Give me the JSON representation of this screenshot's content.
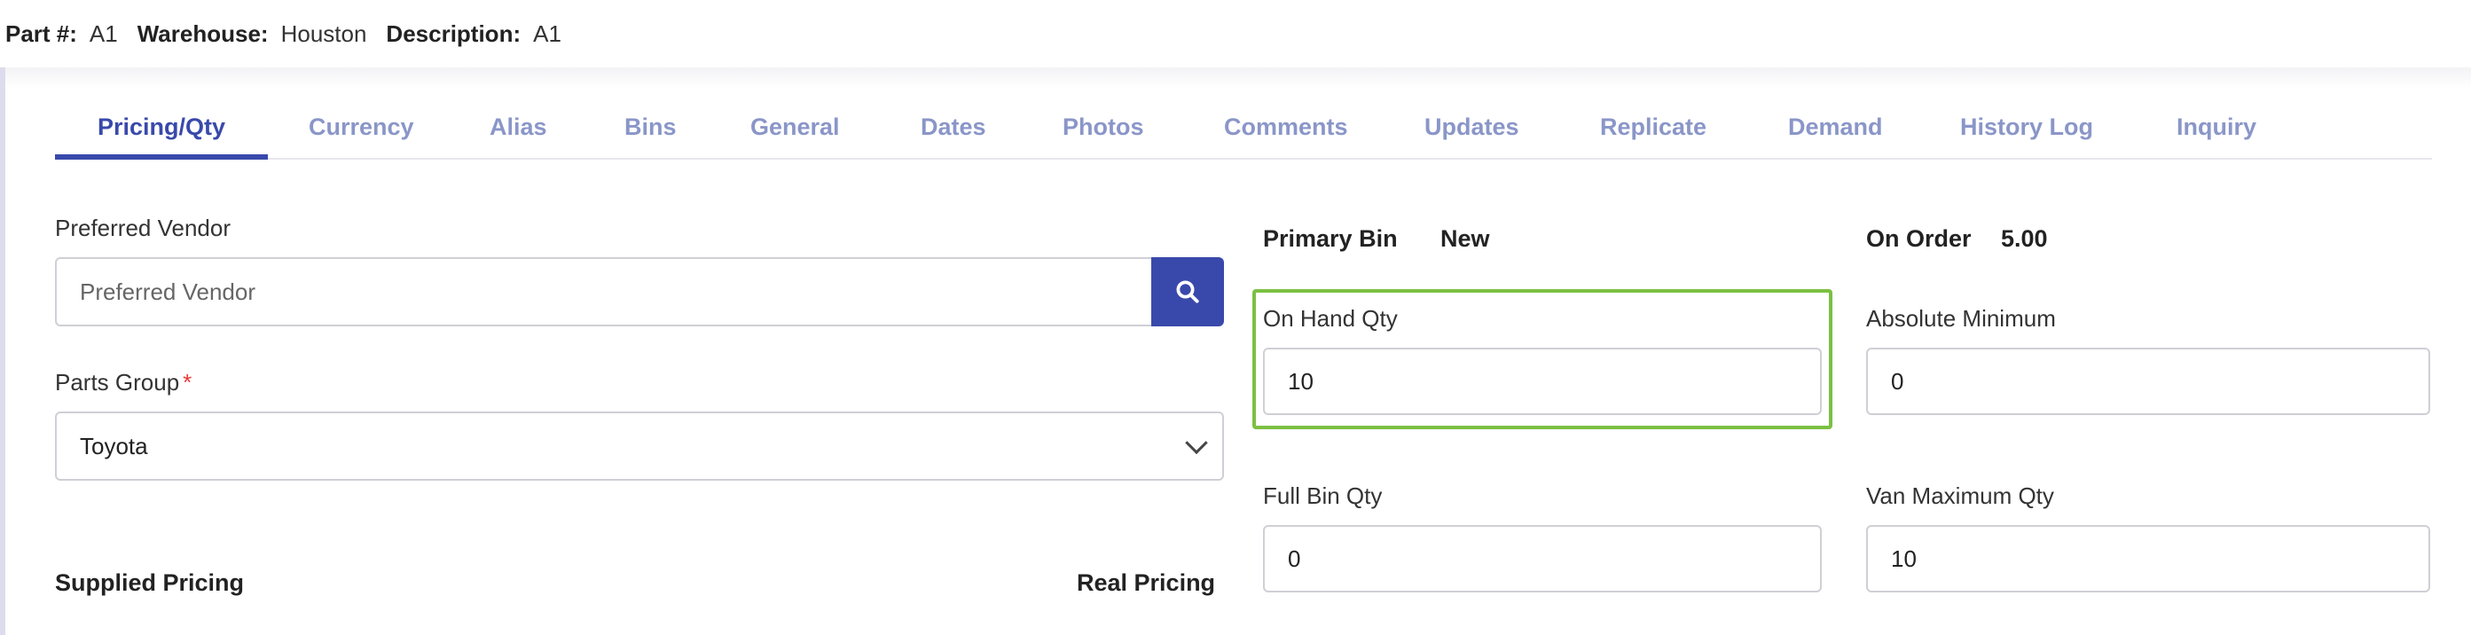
{
  "header": {
    "part_label": "Part #:",
    "part_value": "A1",
    "warehouse_label": "Warehouse:",
    "warehouse_value": "Houston",
    "description_label": "Description:",
    "description_value": "A1"
  },
  "tabs": [
    {
      "label": "Pricing/Qty",
      "active": true
    },
    {
      "label": "Currency"
    },
    {
      "label": "Alias"
    },
    {
      "label": "Bins"
    },
    {
      "label": "General"
    },
    {
      "label": "Dates"
    },
    {
      "label": "Photos"
    },
    {
      "label": "Comments"
    },
    {
      "label": "Updates"
    },
    {
      "label": "Replicate"
    },
    {
      "label": "Demand"
    },
    {
      "label": "History Log"
    },
    {
      "label": "Inquiry"
    }
  ],
  "form": {
    "preferred_vendor": {
      "label": "Preferred Vendor",
      "placeholder": "Preferred Vendor",
      "value": ""
    },
    "parts_group": {
      "label": "Parts Group",
      "required_mark": "*",
      "value": "Toyota"
    },
    "supplied_pricing": "Supplied Pricing",
    "real_pricing": "Real Pricing",
    "primary_bin": {
      "label": "Primary Bin",
      "value": "New"
    },
    "on_order": {
      "label": "On Order",
      "value": "5.00"
    },
    "on_hand_qty": {
      "label": "On Hand Qty",
      "value": "10"
    },
    "absolute_minimum": {
      "label": "Absolute Minimum",
      "value": "0"
    },
    "full_bin_qty": {
      "label": "Full Bin Qty",
      "value": "0"
    },
    "van_maximum_qty": {
      "label": "Van Maximum Qty",
      "value": "10"
    }
  },
  "colors": {
    "accent": "#3949ab",
    "tab_inactive": "#8a96c8",
    "highlight": "#7cc043",
    "required": "#e53935"
  },
  "icons": {
    "vendor_search": "search-icon",
    "parts_group_dropdown": "chevron-down-icon"
  }
}
